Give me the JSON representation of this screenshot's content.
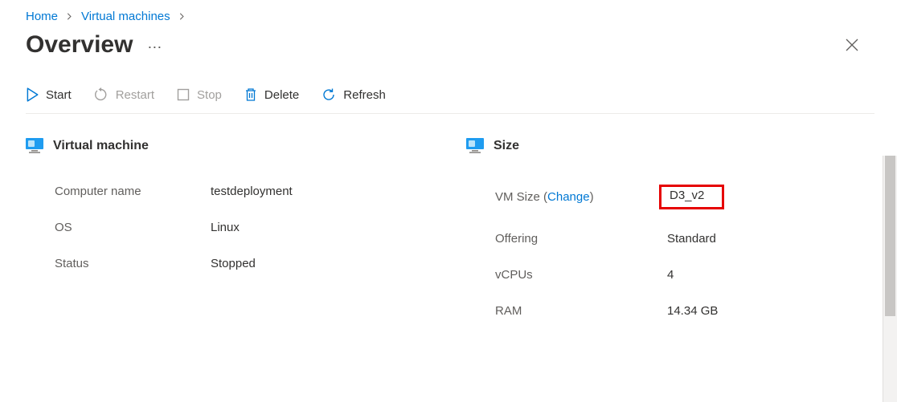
{
  "breadcrumb": {
    "home": "Home",
    "vms": "Virtual machines"
  },
  "title": "Overview",
  "toolbar": {
    "start": "Start",
    "restart": "Restart",
    "stop": "Stop",
    "delete": "Delete",
    "refresh": "Refresh"
  },
  "left_section": {
    "title": "Virtual machine",
    "rows": {
      "computer_name_label": "Computer name",
      "computer_name_value": "testdeployment",
      "os_label": "OS",
      "os_value": "Linux",
      "status_label": "Status",
      "status_value": "Stopped"
    }
  },
  "right_section": {
    "title": "Size",
    "rows": {
      "vm_size_label_pre": "VM Size (",
      "vm_size_change": "Change",
      "vm_size_label_post": ")",
      "vm_size_value": "D3_v2",
      "offering_label": "Offering",
      "offering_value": "Standard",
      "vcpus_label": "vCPUs",
      "vcpus_value": "4",
      "ram_label": "RAM",
      "ram_value": "14.34 GB"
    }
  }
}
